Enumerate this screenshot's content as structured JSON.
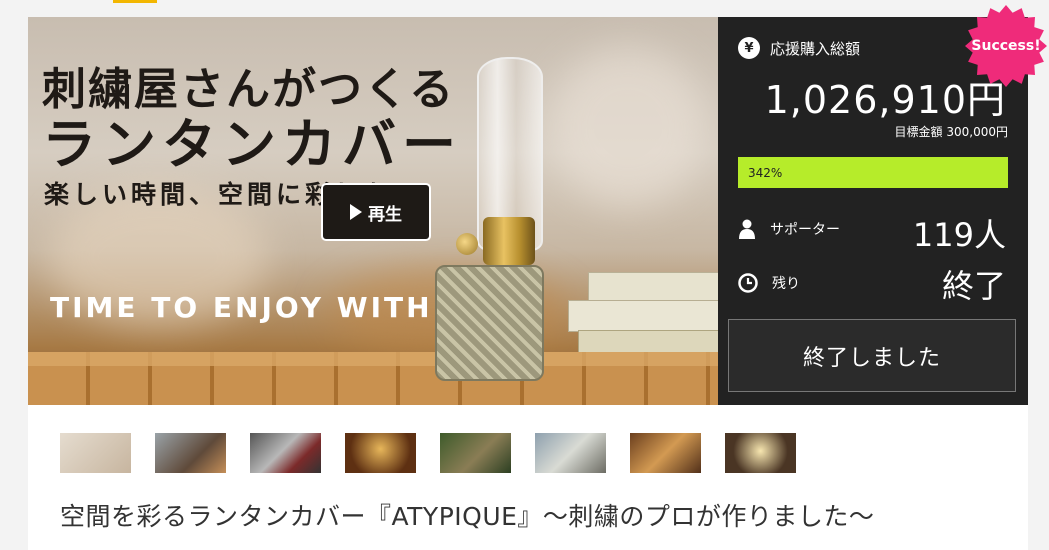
{
  "hero": {
    "title_line1": "刺繍屋さんがつくる",
    "title_line2": "ランタンカバー",
    "subtitle": "楽しい時間、空間に彩りを",
    "play_label": "再生",
    "enjoy_text": "TIME TO ENJOY WITH"
  },
  "badge": {
    "label": "Success!",
    "color": "#ef2b7a"
  },
  "funding": {
    "label": "応援購入総額",
    "currency_icon": "¥",
    "amount": "1,026,910円",
    "target_label": "目標金額 300,000円",
    "progress_text": "342%",
    "progress_fraction": 1.0,
    "bar_color": "#b6ec2a"
  },
  "supporters": {
    "label": "サポーター",
    "value": "119人",
    "icon": "person-icon"
  },
  "remaining": {
    "label": "残り",
    "value": "終了",
    "icon": "clock-icon"
  },
  "status_button": {
    "label": "終了しました"
  },
  "thumbnails": [
    {
      "name": "thumb-1"
    },
    {
      "name": "thumb-2"
    },
    {
      "name": "thumb-3"
    },
    {
      "name": "thumb-4"
    },
    {
      "name": "thumb-5"
    },
    {
      "name": "thumb-6"
    },
    {
      "name": "thumb-7"
    },
    {
      "name": "thumb-8"
    }
  ],
  "product": {
    "title": "空間を彩るランタンカバー『ATYPIQUE』〜刺繍のプロが作りました〜"
  }
}
